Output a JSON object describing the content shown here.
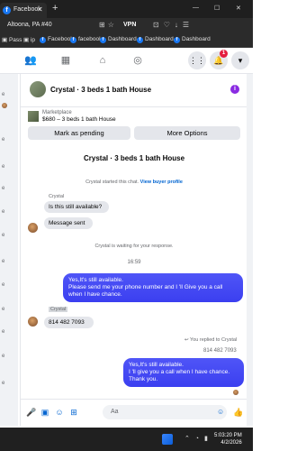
{
  "browser": {
    "tab_title": "Facebook",
    "tab_icon": "facebook-icon",
    "address_text": "Altoona, PA #40",
    "vpn_label": "VPN",
    "bookmarks": [
      {
        "label": "Pass",
        "icon": "folder-icon"
      },
      {
        "label": "ip",
        "icon": "folder-icon"
      },
      {
        "label": "Facebook",
        "icon": "facebook-icon"
      },
      {
        "label": "facebook",
        "icon": "facebook-icon"
      },
      {
        "label": "Dashboard",
        "icon": "facebook-icon"
      },
      {
        "label": "Dashboard",
        "icon": "facebook-icon"
      },
      {
        "label": "Dashboard",
        "icon": "facebook-icon"
      }
    ]
  },
  "fb_nav": {
    "notification_count": "1",
    "icons": [
      "people-icon",
      "calendar-icon",
      "shop-icon",
      "avatar-circle-icon"
    ],
    "right_icons": [
      "grid-menu-icon",
      "bell-icon",
      "chevron-down-icon"
    ]
  },
  "chat": {
    "header_title": "Crystal · 3 beds 1 bath House",
    "listing": {
      "category": "Marketplace",
      "price_line": "$680 – 3 beds 1 bath House",
      "btn_pending": "Mark as pending",
      "btn_more": "More Options"
    },
    "conversation_title": "Crystal · 3 beds 1 bath House",
    "started_text": "Crystal started this chat.",
    "view_profile": "View buyer profile",
    "sender_name": "Crystal",
    "msg_in_1": "Is this still available?",
    "msg_in_2": "Message sent",
    "waiting_text": "Crystal is waiting for your response.",
    "time_sep": "16:59",
    "msg_out_1": "Yes,It's still available.\nPlease send me your phone number and I 'll Give you a call when I have chance.",
    "label_tag": "Crystal",
    "msg_in_3": "814 482 7093",
    "replied_text": "You replied to Crystal",
    "quoted_text": "814 482 7093",
    "msg_out_2": "Yes,It's still available.\nI 'll give you a call when I have chance.\nThank you.",
    "composer_placeholder": "Aa"
  },
  "taskbar": {
    "time": "5:03:20 PM",
    "date": "4/2/2026"
  },
  "colors": {
    "accent": "#0064d1",
    "out_bubble": "#3f44f4",
    "in_bubble": "#e4e6eb",
    "badge": "#e41e3f"
  }
}
